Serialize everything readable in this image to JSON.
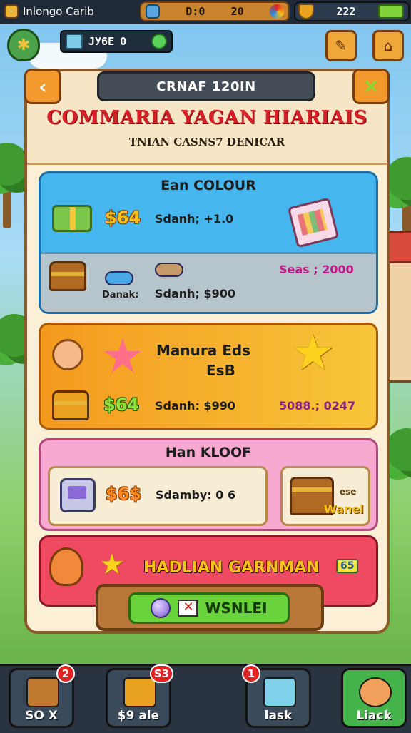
{
  "hud": {
    "player_name": "Inlongo Carib",
    "resource_a": "D:0",
    "resource_b": "20",
    "gems": "222"
  },
  "counter": {
    "label": "ЈУ6Е",
    "value": "0"
  },
  "panel": {
    "title": "CRNAF 120IN",
    "headline": "COMMARIA YAGAN HIARIAIS",
    "subheadline": "TNIAN CASNS7 DENICAR",
    "back_icon": "back-arrow-icon",
    "close_icon": "close-x-icon"
  },
  "cards": {
    "blue": {
      "title": "Ean COLOUR",
      "price": "$64",
      "stat": "Sdanh; +1.0",
      "strip_label_left": "Danak:",
      "strip_label_mid": "Sdanh; $900",
      "strip_label_right": "Seas ; 2000"
    },
    "orange": {
      "title_line1": "Manura Eds",
      "title_line2": "EsB",
      "price": "$64",
      "stat": "Sdanh: $990",
      "right_label": "5088.; 0247"
    },
    "pink": {
      "title": "Han KLOOF",
      "price": "$6$",
      "stat": "Sdamby: 0 6",
      "chest_label_a": "ese",
      "chest_label_b": "Wanel"
    },
    "red": {
      "title": "HADLIAN GARNMAN",
      "tag": "65"
    }
  },
  "main_button": {
    "label": "WSNLEI"
  },
  "nav": [
    {
      "label": "SO  X",
      "badge": "2"
    },
    {
      "label": "$9 ale",
      "badge": "S3"
    },
    {
      "label": "lask",
      "badge": "1"
    },
    {
      "label": "Liack",
      "badge": ""
    }
  ],
  "colors": {
    "blue_card": "#46b6ee",
    "orange_card": "#f6a21e",
    "pink_card": "#f7a9cf",
    "red_card": "#ef4a62",
    "accent_green": "#6ad23a",
    "title_red": "#d61f26"
  }
}
